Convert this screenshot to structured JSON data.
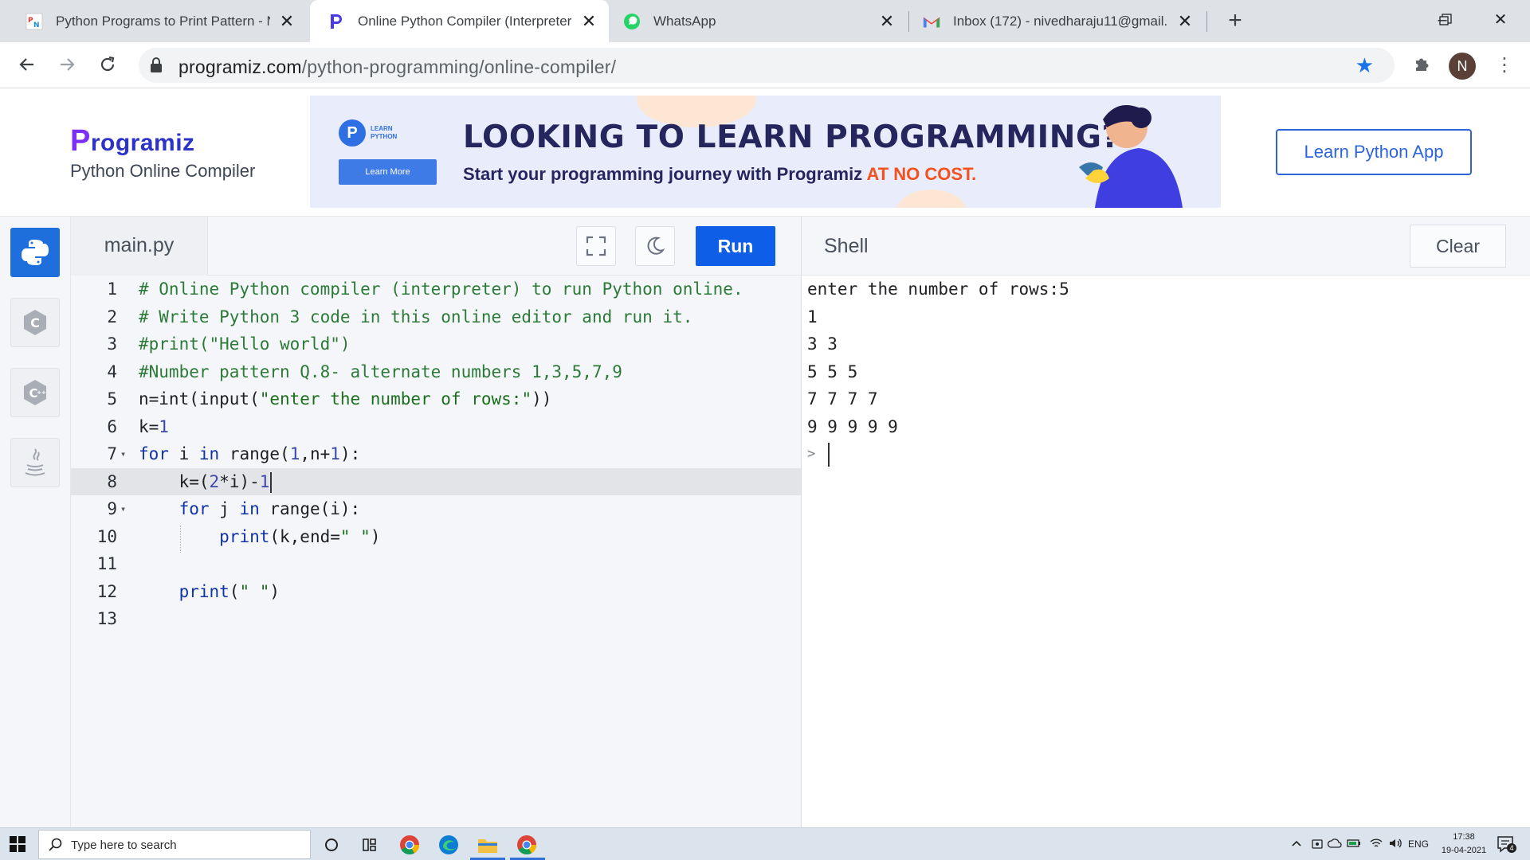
{
  "browser": {
    "tabs": [
      {
        "title": "Python Programs to Print Pattern - N",
        "favicon": "site-favicon-pn",
        "active": false
      },
      {
        "title": "Online Python Compiler (Interpreter",
        "favicon": "programiz-favicon",
        "active": true
      },
      {
        "title": "WhatsApp",
        "favicon": "whatsapp-icon",
        "active": false
      },
      {
        "title": "Inbox (172) - nivedharaju11@gmail.",
        "favicon": "gmail-icon",
        "active": false
      }
    ],
    "url_domain": "programiz.com",
    "url_path": "/python-programming/online-compiler/",
    "profile_initial": "N"
  },
  "header": {
    "logo_text": "rogramiz",
    "logo_letter": "P",
    "subtitle": "Python Online Compiler",
    "learn_app_label": "Learn Python App"
  },
  "banner": {
    "badge_letter": "P",
    "badge_line1": "LEARN",
    "badge_line2": "PYTHON",
    "learn_more": "Learn More",
    "headline": "LOOKING TO LEARN PROGRAMMING?",
    "sub_prefix": "Start your programming journey with Programiz ",
    "sub_accent": "AT NO COST."
  },
  "editor": {
    "filename": "main.py",
    "run_label": "Run",
    "current_line": 8,
    "lines": [
      {
        "n": "1"
      },
      {
        "n": "2"
      },
      {
        "n": "3"
      },
      {
        "n": "4"
      },
      {
        "n": "5"
      },
      {
        "n": "6"
      },
      {
        "n": "7"
      },
      {
        "n": "8"
      },
      {
        "n": "9"
      },
      {
        "n": "10"
      },
      {
        "n": "11"
      },
      {
        "n": "12"
      },
      {
        "n": "13"
      }
    ],
    "code": {
      "l1": "# Online Python compiler (interpreter) to run Python online.",
      "l2": "# Write Python 3 code in this online editor and run it.",
      "l3": "#print(\"Hello world\")",
      "l4": "#Number pattern Q.8- alternate numbers 1,3,5,7,9",
      "l5_a": "n=int(input(",
      "l5_s": "\"enter the number of rows:\"",
      "l5_b": "))",
      "l6_a": "k=",
      "l6_n": "1",
      "l7_kw1": "for",
      "l7_a": " i ",
      "l7_kw2": "in",
      "l7_b": " range(",
      "l7_n1": "1",
      "l7_c": ",n+",
      "l7_n2": "1",
      "l7_d": "):",
      "l8_a": "    k=(",
      "l8_n1": "2",
      "l8_b": "*i)-",
      "l8_n2": "1",
      "l9_ind": "    ",
      "l9_kw1": "for",
      "l9_a": " j ",
      "l9_kw2": "in",
      "l9_b": " range(i):",
      "l10_ind": "        ",
      "l10_fn": "print",
      "l10_a": "(k,end=",
      "l10_s": "\" \"",
      "l10_b": ")",
      "l12_ind": "    ",
      "l12_fn": "print",
      "l12_a": "(",
      "l12_s": "\" \"",
      "l12_b": ")"
    }
  },
  "shell": {
    "title": "Shell",
    "clear_label": "Clear",
    "output": [
      "enter the number of rows:5",
      "1",
      "3 3",
      "5 5 5",
      "7 7 7 7",
      "9 9 9 9 9"
    ],
    "prompt": ">"
  },
  "taskbar": {
    "search_placeholder": "Type here to search",
    "language": "ENG",
    "time": "17:38",
    "date": "19-04-2021",
    "notification_count": "4"
  },
  "colors": {
    "accent": "#0f5ee8",
    "programiz_blue": "#2d33c9",
    "banner_accent": "#f4511e"
  }
}
